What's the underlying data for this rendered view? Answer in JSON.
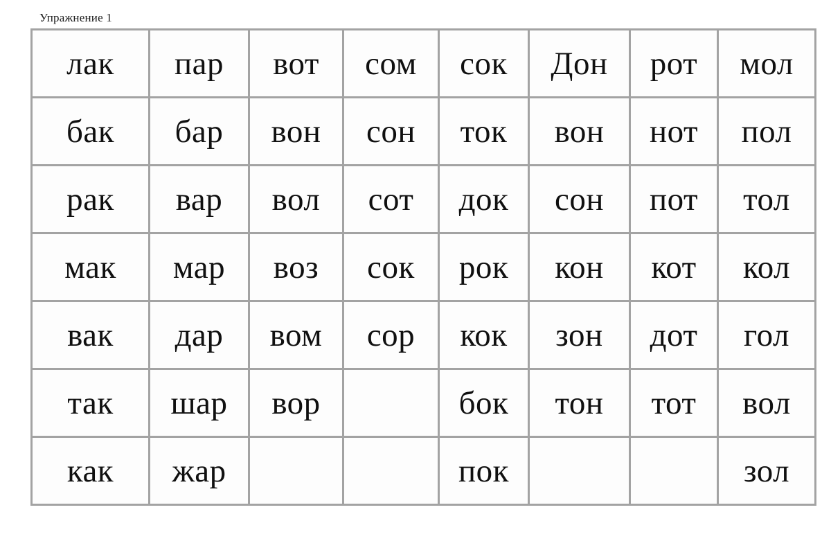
{
  "document": {
    "title": "Упражнение 1",
    "background_color": "#ffffff",
    "text_color": "#101010",
    "border_color": "#a3a3a3"
  },
  "chart_data": {
    "type": "table",
    "title": "Упражнение 1",
    "rows": 7,
    "columns": 8,
    "grid": [
      [
        "лак",
        "пар",
        "вот",
        "сом",
        "сок",
        "Дон",
        "рот",
        "мол"
      ],
      [
        "бак",
        "бар",
        "вон",
        "сон",
        "ток",
        "вон",
        "нот",
        "пол"
      ],
      [
        "рак",
        "вар",
        "вол",
        "сот",
        "док",
        "сон",
        "пот",
        "тол"
      ],
      [
        "мак",
        "мар",
        "воз",
        "сок",
        "рок",
        "кон",
        "кот",
        "кол"
      ],
      [
        "вак",
        "дар",
        "вом",
        "сор",
        "кок",
        "зон",
        "дот",
        "гол"
      ],
      [
        "так",
        "шар",
        "вор",
        "",
        "бок",
        "тон",
        "тот",
        "вол"
      ],
      [
        "как",
        "жар",
        "",
        "",
        "пок",
        "",
        "",
        "зол"
      ]
    ]
  },
  "table": {
    "rows": [
      {
        "cells": [
          {
            "text": "лак"
          },
          {
            "text": "пар"
          },
          {
            "text": "вот"
          },
          {
            "text": "сом"
          },
          {
            "text": "сок"
          },
          {
            "text": "Дон"
          },
          {
            "text": "рот"
          },
          {
            "text": "мол"
          }
        ]
      },
      {
        "cells": [
          {
            "text": "бак"
          },
          {
            "text": "бар"
          },
          {
            "text": "вон"
          },
          {
            "text": "сон"
          },
          {
            "text": "ток"
          },
          {
            "text": "вон"
          },
          {
            "text": "нот"
          },
          {
            "text": "пол"
          }
        ]
      },
      {
        "cells": [
          {
            "text": "рак"
          },
          {
            "text": "вар"
          },
          {
            "text": "вол"
          },
          {
            "text": "сот"
          },
          {
            "text": "док"
          },
          {
            "text": "сон"
          },
          {
            "text": "пот"
          },
          {
            "text": "тол"
          }
        ]
      },
      {
        "cells": [
          {
            "text": "мак"
          },
          {
            "text": "мар"
          },
          {
            "text": "воз"
          },
          {
            "text": "сок"
          },
          {
            "text": "рок"
          },
          {
            "text": "кон"
          },
          {
            "text": "кот"
          },
          {
            "text": "кол"
          }
        ]
      },
      {
        "cells": [
          {
            "text": "вак"
          },
          {
            "text": "дар"
          },
          {
            "text": "вом"
          },
          {
            "text": "сор"
          },
          {
            "text": "кок"
          },
          {
            "text": "зон"
          },
          {
            "text": "дот"
          },
          {
            "text": "гол"
          }
        ]
      },
      {
        "cells": [
          {
            "text": "так"
          },
          {
            "text": "шар"
          },
          {
            "text": "вор"
          },
          {
            "text": ""
          },
          {
            "text": "бок"
          },
          {
            "text": "тон"
          },
          {
            "text": "тот"
          },
          {
            "text": "вол"
          }
        ]
      },
      {
        "cells": [
          {
            "text": "как"
          },
          {
            "text": "жар"
          },
          {
            "text": ""
          },
          {
            "text": ""
          },
          {
            "text": "пок"
          },
          {
            "text": ""
          },
          {
            "text": ""
          },
          {
            "text": "зол"
          }
        ]
      }
    ]
  }
}
